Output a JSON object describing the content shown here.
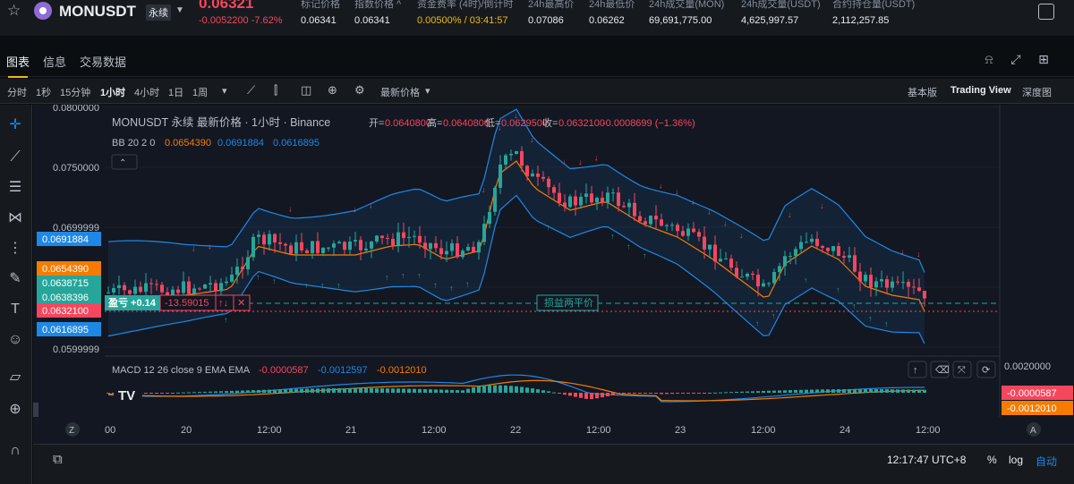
{
  "header": {
    "symbol": "MONUSDT",
    "contract": "永续",
    "last_price": "0.06321",
    "change": "-0.0052200 -7.62%",
    "stats": [
      {
        "label": "标记价格",
        "value": "0.06341"
      },
      {
        "label": "指数价格 ^",
        "value": "0.06341"
      },
      {
        "label": "资金费率 (4时)/倒计时",
        "value": "0.00500% / 03:41:57"
      },
      {
        "label": "24h最高价",
        "value": "0.07086"
      },
      {
        "label": "24h最低价",
        "value": "0.06262"
      },
      {
        "label": "24h成交量(MON)",
        "value": "69,691,775.00"
      },
      {
        "label": "24h成交量(USDT)",
        "value": "4,625,997.57"
      },
      {
        "label": "合约持仓量(USDT)",
        "value": "2,112,257.85"
      }
    ]
  },
  "tabs": [
    "图表",
    "信息",
    "交易数据"
  ],
  "toolbar": {
    "intervals": [
      "分时",
      "1秒",
      "15分钟",
      "1小时",
      "4小时",
      "1日",
      "1周"
    ],
    "active_interval": "1小时",
    "price_type": "最新价格",
    "views": [
      "基本版",
      "Trading View",
      "深度图"
    ],
    "active_view": "Trading View"
  },
  "chart": {
    "title_line": "MONUSDT 永续 最新价格 · 1小时 · Binance",
    "ohlc": {
      "o_label": "开=",
      "o": "0.0640800",
      "h_label": "高=",
      "h": "0.0640800",
      "l_label": "低=",
      "l": "0.0629500",
      "c_label": "收=",
      "c": "0.0632100",
      "chg": "-0.0008699 (−1.36%)"
    },
    "bb_label": "BB 20 2 0",
    "bb_values": [
      "0.0654390",
      "0.0691884",
      "0.0616895"
    ],
    "macd_label": "MACD 12 26 close 9 EMA EMA",
    "macd_values": [
      "-0.0000587",
      "-0.0012597",
      "-0.0012010"
    ],
    "y_ticks": [
      "0.0800000",
      "0.0750000",
      "0.0699999",
      "0.0599999"
    ],
    "macd_tick": "0.0020000",
    "price_tags": [
      {
        "value": "0.0691884",
        "color": "#1e88e5"
      },
      {
        "value": "0.0654390",
        "color": "#f57c00"
      },
      {
        "value": "0.0638715",
        "color": "#26a69a"
      },
      {
        "value": "0.0638396",
        "color": "#26a69a"
      },
      {
        "value": "0.0632100",
        "color": "#f6465d"
      },
      {
        "value": "0.0616895",
        "color": "#1e88e5"
      }
    ],
    "macd_tags": [
      {
        "value": "-0.0000587",
        "color": "#f6465d"
      },
      {
        "value": "-0.0012010",
        "color": "#f57c00"
      }
    ],
    "position": {
      "label": "盈亏 +0.14",
      "qty": "-13.59015",
      "tpsl": "↑↓",
      "close": "✕"
    },
    "tpsl_line_label": "损益两平价",
    "x_ticks": [
      "00",
      "20",
      "12:00",
      "21",
      "12:00",
      "22",
      "12:00",
      "23",
      "12:00",
      "24",
      "12:00"
    ]
  },
  "status": {
    "clock": "12:17:47 UTC+8",
    "pct": "%",
    "log": "log",
    "auto": "自动"
  },
  "colors": {
    "up": "#26a69a",
    "down": "#f6465d",
    "bb_mid": "#f57c00",
    "bb_band": "#1e88e5"
  }
}
